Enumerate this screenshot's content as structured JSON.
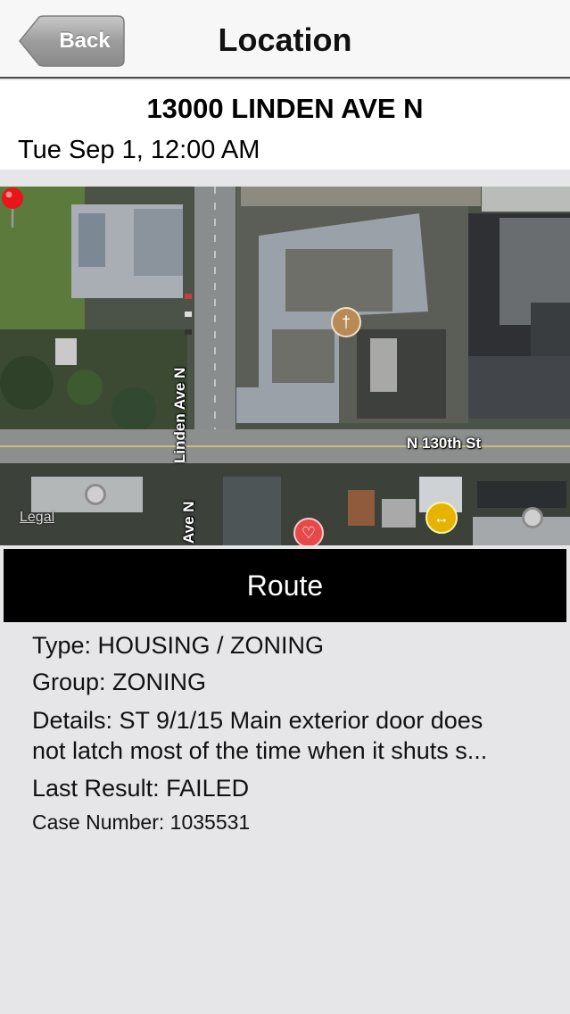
{
  "navbar": {
    "back_label": "Back",
    "title": "Location"
  },
  "location": {
    "address": "13000 LINDEN AVE N",
    "datetime": "Tue Sep 1, 12:00 AM"
  },
  "map": {
    "road_labels": [
      "Linden Ave N",
      "N 130th St",
      "Ave N"
    ],
    "legal_label": "Legal",
    "pins": [
      "dropped-pin",
      "restaurant",
      "fitness",
      "dentist",
      "point-of-interest",
      "point-of-interest"
    ],
    "colors": {
      "pin": "#e8151b",
      "restaurant": "#b88a55",
      "fitness": "#e6b400",
      "dentist": "#e54a4a"
    }
  },
  "route_button": {
    "label": "Route"
  },
  "details": {
    "type": "Type: HOUSING / ZONING",
    "group": "Group: ZONING",
    "details_line1": "Details: ST 9/1/15 Main exterior door does",
    "details_line2": "not latch most of the time when it shuts s...",
    "last_result": "Last Result: FAILED",
    "case_number": "Case Number: 1035531"
  }
}
